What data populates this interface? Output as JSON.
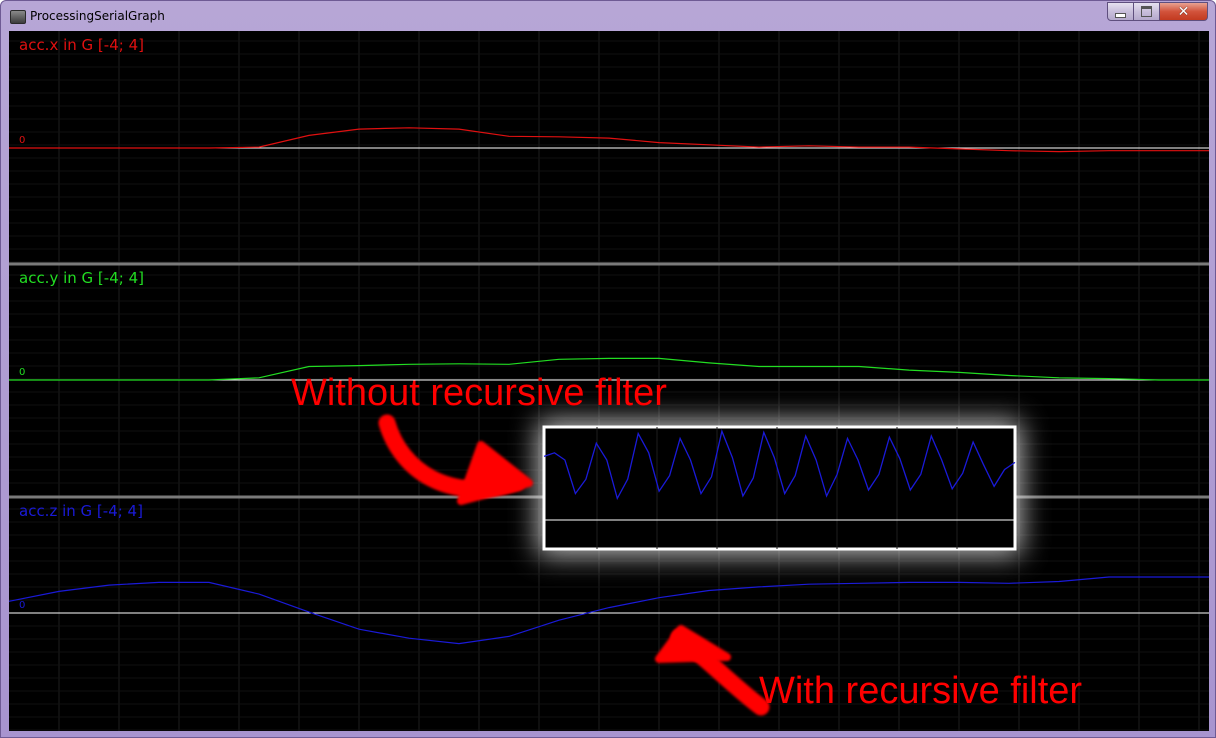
{
  "window": {
    "title": "ProcessingSerialGraph",
    "app_icon": "processing-app-icon",
    "controls": {
      "minimize_icon": "minimize-icon",
      "maximize_icon": "maximize-icon",
      "close_icon": "close-icon",
      "close_glyph": "✕"
    }
  },
  "colors": {
    "background": "#000000",
    "grid": "#1e1e1e",
    "zero_line": "#ffffff",
    "divider": "#7a7a7a",
    "x_series": "#e01010",
    "y_series": "#22dd22",
    "z_series": "#1a1ad8",
    "annotation": "#ff0000"
  },
  "graphs": [
    {
      "label": "acc.x in G [-4; 4]",
      "zero_label": "0"
    },
    {
      "label": "acc.y in G [-4; 4]",
      "zero_label": "0"
    },
    {
      "label": "acc.z in G [-4; 4]",
      "zero_label": "0"
    }
  ],
  "annotations": {
    "without": "Without recursive filter",
    "with": "With recursive filter"
  },
  "chart_data": [
    {
      "type": "line",
      "title": "acc.x in G [-4; 4]",
      "ylim": [
        -4,
        4
      ],
      "x": [
        0,
        50,
        100,
        150,
        200,
        250,
        300,
        350,
        400,
        450,
        500,
        550,
        600,
        650,
        700,
        750,
        800,
        850,
        900,
        950,
        1000,
        1050,
        1100,
        1150,
        1200
      ],
      "series": [
        {
          "values": [
            0,
            0,
            0,
            0,
            0,
            0.02,
            0.28,
            0.42,
            0.45,
            0.42,
            0.26,
            0.25,
            0.22,
            0.12,
            0.07,
            0.02,
            0.05,
            0.02,
            0.02,
            -0.02,
            -0.06,
            -0.08,
            -0.06,
            -0.06,
            -0.06
          ]
        }
      ]
    },
    {
      "type": "line",
      "title": "acc.y in G [-4; 4]",
      "ylim": [
        -4,
        4
      ],
      "x": [
        0,
        50,
        100,
        150,
        200,
        250,
        300,
        350,
        400,
        450,
        500,
        550,
        600,
        650,
        700,
        750,
        800,
        850,
        900,
        950,
        1000,
        1050,
        1100,
        1150,
        1200
      ],
      "series": [
        {
          "values": [
            0,
            0,
            0,
            0,
            0,
            0.05,
            0.3,
            0.32,
            0.35,
            0.36,
            0.35,
            0.46,
            0.48,
            0.48,
            0.38,
            0.3,
            0.3,
            0.3,
            0.22,
            0.17,
            0.1,
            0.05,
            0.03,
            0,
            0
          ]
        }
      ]
    },
    {
      "type": "line",
      "title": "acc.z in G [-4; 4]",
      "ylim": [
        -4,
        4
      ],
      "x": [
        0,
        50,
        100,
        150,
        200,
        250,
        300,
        350,
        400,
        450,
        500,
        550,
        600,
        650,
        700,
        750,
        800,
        850,
        900,
        950,
        1000,
        1050,
        1100,
        1150,
        1200
      ],
      "series": [
        {
          "values": [
            0.26,
            0.48,
            0.62,
            0.68,
            0.68,
            0.42,
            0.02,
            -0.36,
            -0.56,
            -0.68,
            -0.52,
            -0.16,
            0.12,
            0.34,
            0.5,
            0.58,
            0.64,
            0.66,
            0.68,
            0.68,
            0.66,
            0.7,
            0.8,
            0.8,
            0.8
          ]
        }
      ]
    },
    {
      "type": "line",
      "title": "",
      "ylim": [
        -4,
        4
      ],
      "series": [
        {
          "values": [
            1.3,
            1.6,
            1.0,
            -1.8,
            -0.6,
            2.4,
            1.0,
            -2.2,
            -0.6,
            3.2,
            1.6,
            -1.6,
            -0.3,
            2.8,
            1.0,
            -1.8,
            -0.4,
            3.4,
            1.2,
            -2.0,
            -0.5,
            3.3,
            1.2,
            -1.8,
            -0.3,
            3.0,
            1.0,
            -2.0,
            -0.2,
            2.8,
            1.0,
            -1.5,
            -0.2,
            2.9,
            1.1,
            -1.5,
            -0.2,
            3.0,
            1.0,
            -1.4,
            -0.1,
            2.5,
            0.6,
            -1.2,
            0.2,
            0.8
          ]
        }
      ]
    }
  ]
}
